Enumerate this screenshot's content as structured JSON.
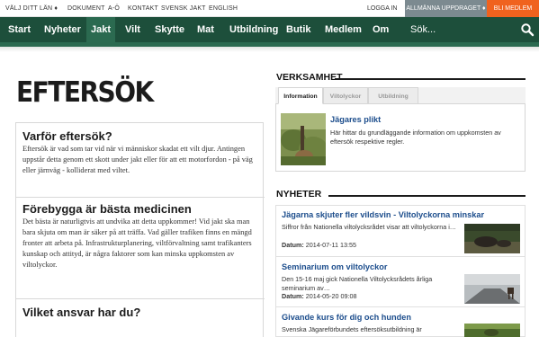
{
  "topbar": {
    "links": [
      "VÄLJ DITT LÄN ♦",
      "DOKUMENT",
      "A-Ö",
      "KONTAKT",
      "SVENSK JAKT",
      "ENGLISH"
    ],
    "login": "LOGGA IN",
    "allmanna": "ALLMÄNNA UPPDRAGET ♦",
    "bli_medlem": "BLI MEDLEM"
  },
  "nav": {
    "items": [
      "Start",
      "Nyheter",
      "Jakt",
      "Vilt",
      "Skytte",
      "Mat",
      "Utbildning",
      "Butik",
      "Medlem",
      "Om"
    ],
    "active": "Jakt",
    "search_placeholder": "Sök...",
    "accent": "#1d4f3b"
  },
  "page": {
    "title": "EFTERSÖK"
  },
  "sections": [
    {
      "heading": "Varför eftersök?",
      "text": "Eftersök är vad som tar vid när vi människor skadat ett vilt djur. Antingen uppstår detta genom ett skott under jakt eller för att ett motorfordon - på väg eller järnväg - kolliderat med viltet."
    },
    {
      "heading": "Förebygga är bästa medicinen",
      "text": "Det bästa är naturligtvis att undvika att detta uppkommer! Vid jakt ska man bara skjuta om man är säker på att träffa. Vad gäller trafiken finns en mängd fronter att arbeta på. Infrastrukturplanering, viltförvaltning samt trafikanters kunskap och attityd, är några faktorer som kan minska uppkomsten av viltolyckor."
    },
    {
      "heading": "Vilket ansvar har du?",
      "text": ""
    }
  ],
  "verksamhet": {
    "heading": "VERKSAMHET",
    "tabs": [
      "Information",
      "Viltolyckor",
      "Utbildning"
    ],
    "active_tab": "Information",
    "item": {
      "title": "Jägares plikt",
      "text": "Här hittar du grundläggande information om uppkomsten av eftersök respektive regler."
    }
  },
  "nyheter": {
    "heading": "NYHETER",
    "datum_label": "Datum:",
    "items": [
      {
        "title": "Jägarna skjuter fler vildsvin - Viltolyckorna minskar",
        "text": "Siffror från Nationella viltolycksrådet visar att viltolyckorna i…",
        "date": "2014-07-11 13:55"
      },
      {
        "title": "Seminarium om viltolyckor",
        "text": "Den 15-16 maj gick Nationella Viltolycksrådets årliga seminarium av…",
        "date": "2014-05-20 09:08"
      },
      {
        "title": "Givande kurs för dig och hunden",
        "text": "Svenska Jägareförbundets eftersöksutbildning är"
      }
    ]
  },
  "icons": {
    "search": "search-icon"
  }
}
